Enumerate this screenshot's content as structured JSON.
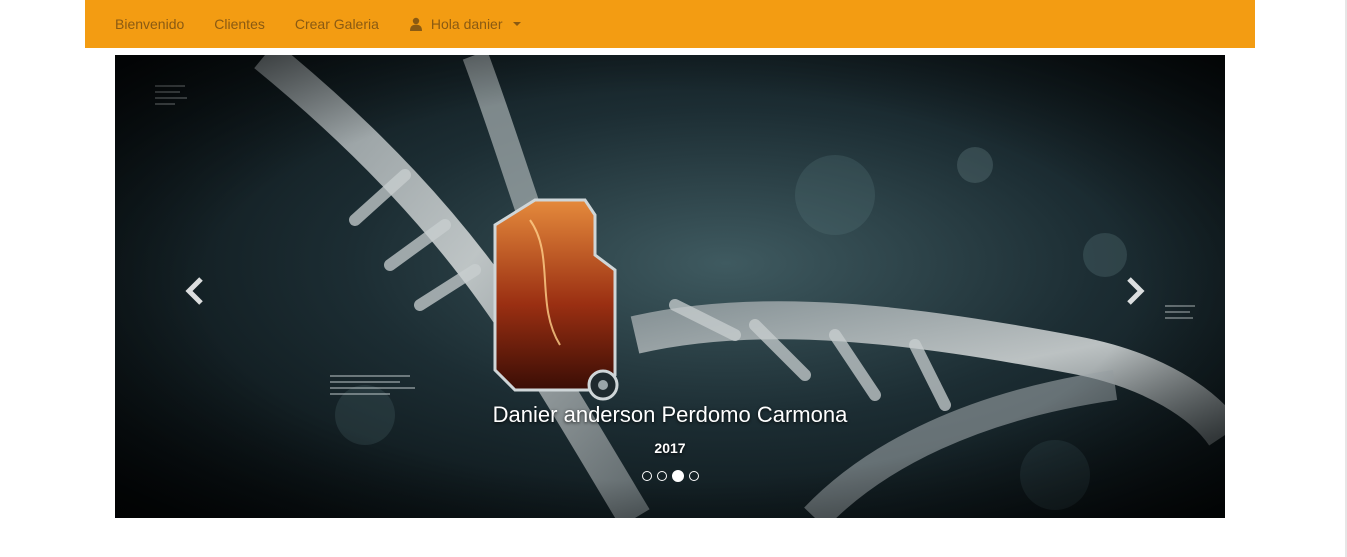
{
  "nav": {
    "items": [
      {
        "label": "Bienvenido"
      },
      {
        "label": "Clientes"
      },
      {
        "label": "Crear Galeria"
      }
    ],
    "user_menu": {
      "label": "Hola danier",
      "icon": "user-icon"
    }
  },
  "carousel": {
    "caption_title": "Danier anderson Perdomo Carmona",
    "caption_year": "2017",
    "indicator_count": 4,
    "active_index": 2,
    "prev_icon": "chevron-left-icon",
    "next_icon": "chevron-right-icon"
  },
  "colors": {
    "navbar": "#f39c12",
    "nav_text": "#8a5a12"
  }
}
